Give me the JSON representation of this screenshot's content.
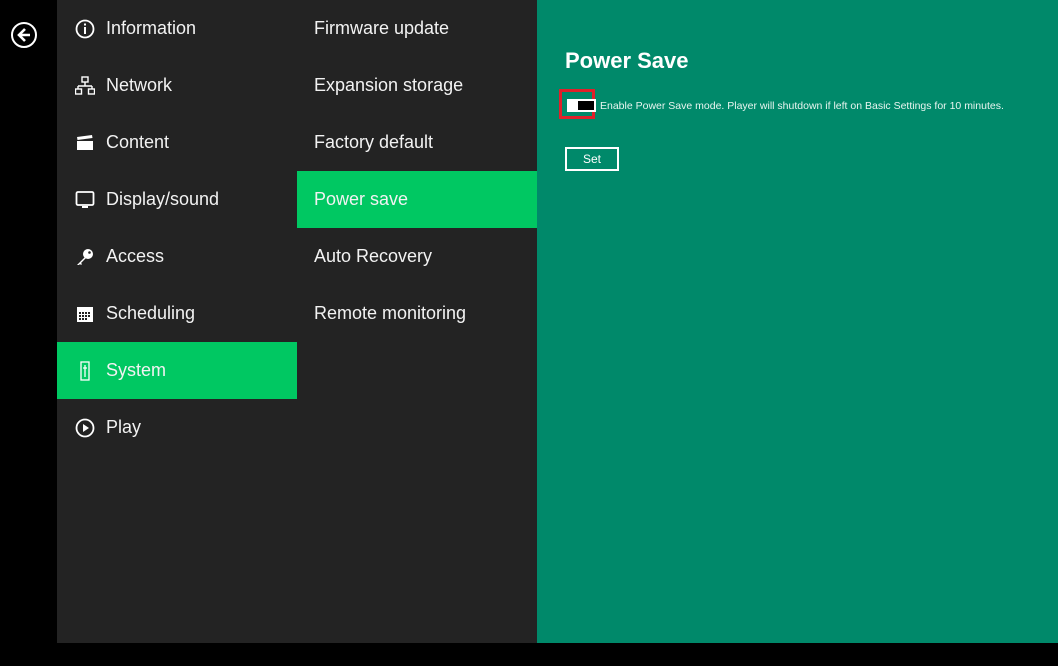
{
  "sidebar": {
    "items": [
      {
        "label": "Information",
        "icon": "info-icon"
      },
      {
        "label": "Network",
        "icon": "network-icon"
      },
      {
        "label": "Content",
        "icon": "clapperboard-icon"
      },
      {
        "label": "Display/sound",
        "icon": "monitor-icon"
      },
      {
        "label": "Access",
        "icon": "key-icon"
      },
      {
        "label": "Scheduling",
        "icon": "calendar-icon"
      },
      {
        "label": "System",
        "icon": "system-icon",
        "active": true
      },
      {
        "label": "Play",
        "icon": "play-icon"
      }
    ]
  },
  "submenu": {
    "items": [
      {
        "label": "Firmware update"
      },
      {
        "label": "Expansion storage"
      },
      {
        "label": "Factory default"
      },
      {
        "label": "Power save",
        "active": true
      },
      {
        "label": "Auto Recovery"
      },
      {
        "label": "Remote monitoring"
      }
    ]
  },
  "content": {
    "title": "Power Save",
    "description": "Enable Power Save mode. Player will shutdown if left on Basic Settings for 10 minutes.",
    "toggle_state": "off",
    "set_label": "Set"
  },
  "colors": {
    "accent_green": "#00c862",
    "panel_green": "#00896a",
    "menu_bg": "#232323",
    "highlight_red": "#e0202a"
  }
}
